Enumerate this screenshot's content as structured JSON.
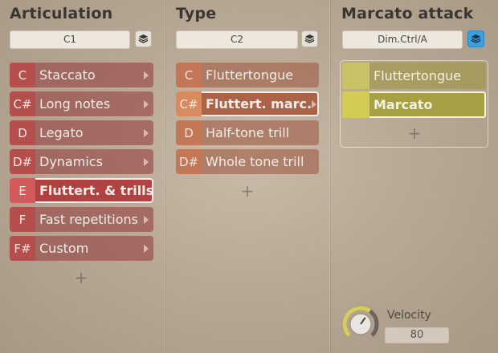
{
  "articulation": {
    "title": "Articulation",
    "selector": "C1",
    "items": [
      {
        "key": "C",
        "label": "Staccato"
      },
      {
        "key": "C#",
        "label": "Long notes"
      },
      {
        "key": "D",
        "label": "Legato"
      },
      {
        "key": "D#",
        "label": "Dynamics"
      },
      {
        "key": "E",
        "label": "Fluttert. & trills"
      },
      {
        "key": "F",
        "label": "Fast repetitions"
      },
      {
        "key": "F#",
        "label": "Custom"
      }
    ],
    "selected_index": 4,
    "add_label": "+"
  },
  "type": {
    "title": "Type",
    "selector": "C2",
    "items": [
      {
        "key": "C",
        "label": "Fluttertongue"
      },
      {
        "key": "C#",
        "label": "Fluttert. marc."
      },
      {
        "key": "D",
        "label": "Half-tone trill"
      },
      {
        "key": "D#",
        "label": "Whole tone trill"
      }
    ],
    "selected_index": 1,
    "add_label": "+"
  },
  "attack": {
    "title": "Marcato attack",
    "selector": "Dim.Ctrl/A",
    "items": [
      {
        "label": "Fluttertongue"
      },
      {
        "label": "Marcato"
      }
    ],
    "selected_index": 1,
    "add_label": "+"
  },
  "velocity": {
    "label": "Velocity",
    "value": "80",
    "level": 0.63
  },
  "colors": {
    "articulation_accent": "#b84b4b",
    "type_accent": "#c87652",
    "attack_accent": "#c9c266",
    "layers_active": "#3aa0e0",
    "knob_ring": "#d6d05a"
  }
}
